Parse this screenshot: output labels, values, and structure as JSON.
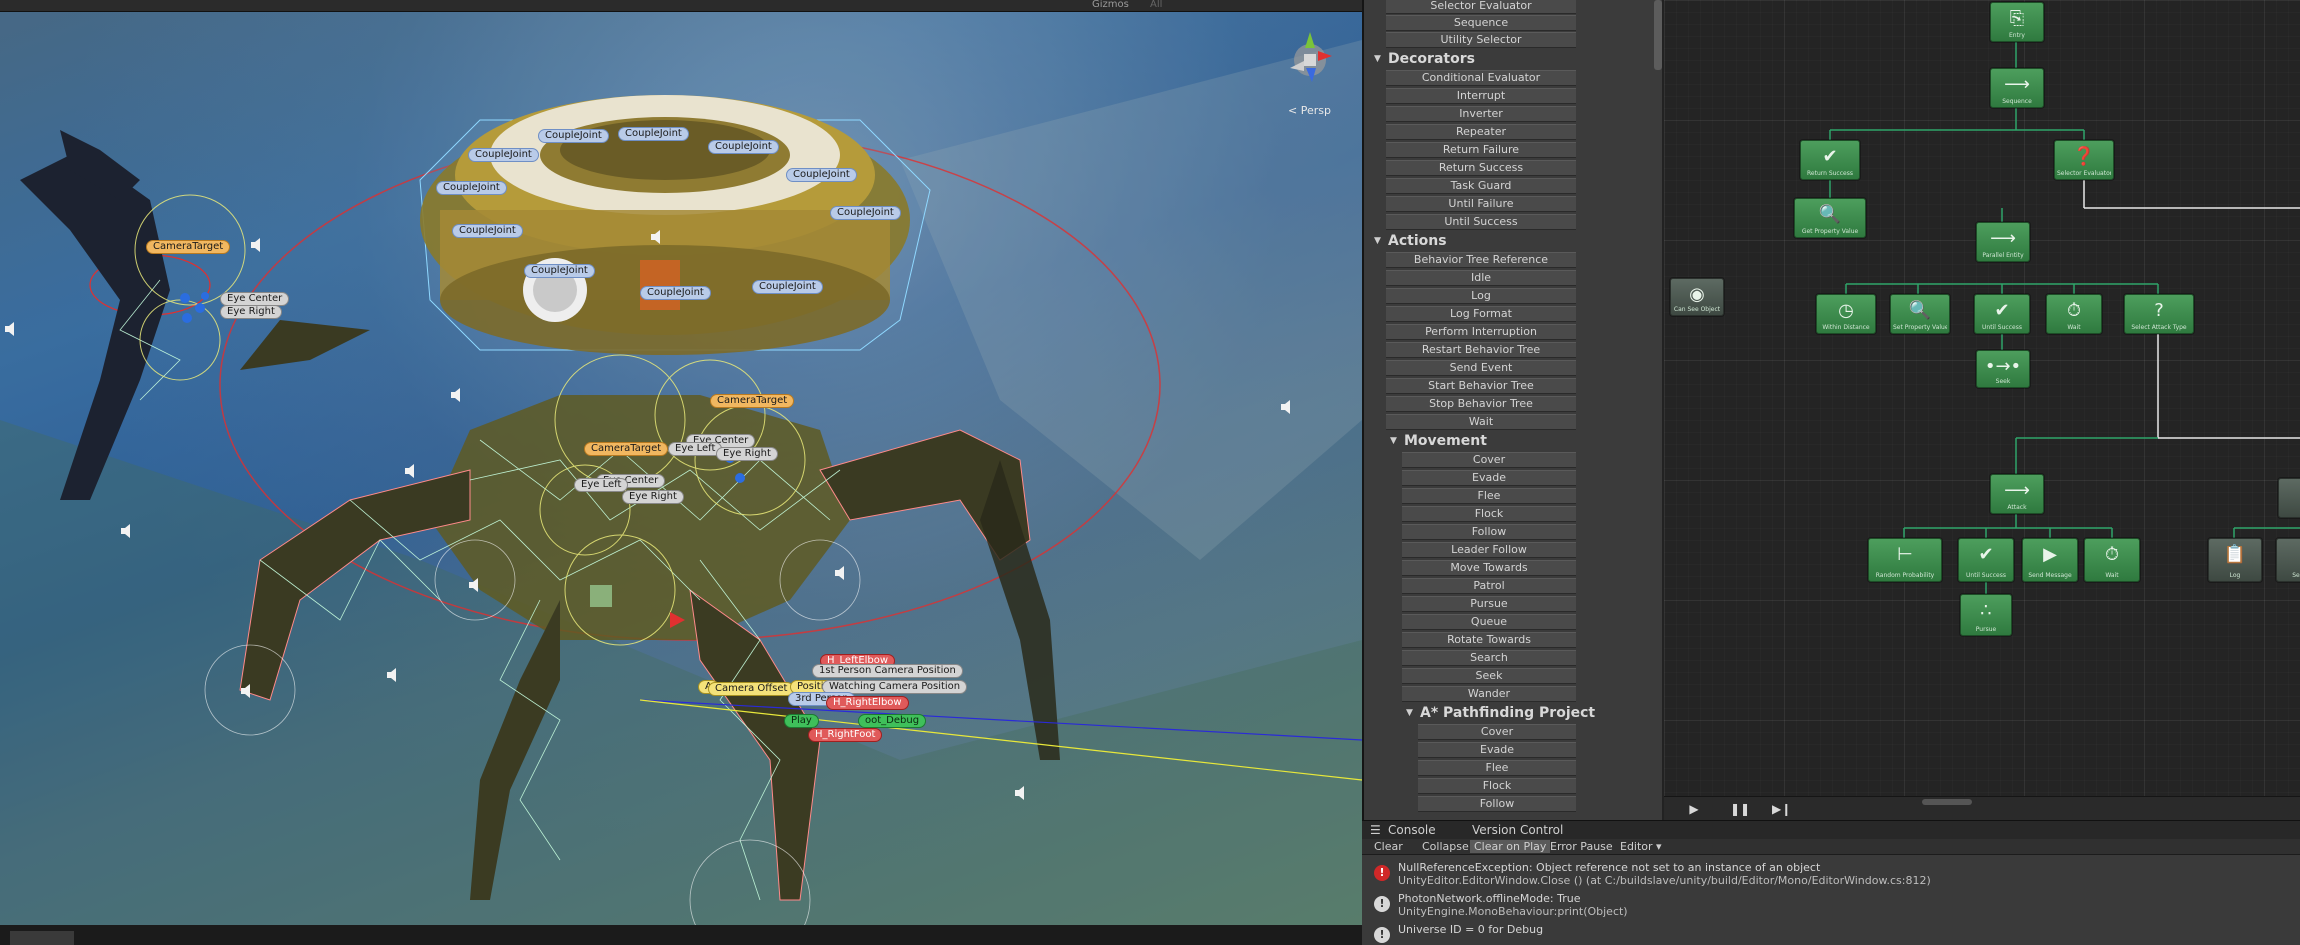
{
  "scene": {
    "toolbar": {
      "gizmos_label": "Gizmos",
      "search_label": "All"
    },
    "persp_label": "Persp",
    "labels": {
      "couplejoint": "CoupleJoint",
      "camera_target": "CameraTarget",
      "eye_center": "Eye Center",
      "eye_right": "Eye Right",
      "eye_left": "Eye Left",
      "h_left_elbow": "H_LeftElbow",
      "first_person_cam": "1st Person Camera Position",
      "camera_offset": "Camera Offset",
      "position": "Position",
      "watching_camera": "Watching Camera Position",
      "third_person": "3rd Person",
      "h_right_elbow": "H_RightElbow",
      "player_debug": "Play",
      "foot_debug": "oot_Debug",
      "h_right_foot": "H_RightFoot",
      "a_label": "A"
    }
  },
  "tasks": {
    "composites_tail": [
      "Selector Evaluator",
      "Sequence",
      "Utility Selector"
    ],
    "decorators": {
      "title": "Decorators",
      "items": [
        "Conditional Evaluator",
        "Interrupt",
        "Inverter",
        "Repeater",
        "Return Failure",
        "Return Success",
        "Task Guard",
        "Until Failure",
        "Until Success"
      ]
    },
    "actions": {
      "title": "Actions",
      "items": [
        "Behavior Tree Reference",
        "Idle",
        "Log",
        "Log Format",
        "Perform Interruption",
        "Restart Behavior Tree",
        "Send Event",
        "Start Behavior Tree",
        "Stop Behavior Tree",
        "Wait"
      ]
    },
    "movement": {
      "title": "Movement",
      "items": [
        "Cover",
        "Evade",
        "Flee",
        "Flock",
        "Follow",
        "Leader Follow",
        "Move Towards",
        "Patrol",
        "Pursue",
        "Queue",
        "Rotate Towards",
        "Search",
        "Seek",
        "Wander"
      ]
    },
    "pathfinding": {
      "title": "A* Pathfinding Project",
      "items": [
        "Cover",
        "Evade",
        "Flee",
        "Flock",
        "Follow"
      ]
    }
  },
  "graph": {
    "nodes": {
      "entry": {
        "label": "Entry"
      },
      "root_seq": {
        "label": "Sequence"
      },
      "return_success": {
        "label": "Return Success"
      },
      "selector_eval": {
        "label": "Selector Evaluator"
      },
      "get_property": {
        "label": "Get Property Value"
      },
      "can_see": {
        "label": "Can See Object"
      },
      "inner_seq": {
        "label": "Parallel Entity"
      },
      "within_distance": {
        "label": "Within Distance"
      },
      "set_property": {
        "label": "Set Property Value"
      },
      "wait_success": {
        "label": "Until Success"
      },
      "wait": {
        "label": "Wait"
      },
      "select_attack": {
        "label": "Select Attack Type"
      },
      "seek": {
        "label": "Seek"
      },
      "attack_seq": {
        "label": "Attack"
      },
      "random_probability": {
        "label": "Random Probability"
      },
      "until_success2": {
        "label": "Until Success"
      },
      "send_message": {
        "label": "Send Message"
      },
      "wait2": {
        "label": "Wait"
      },
      "pursue": {
        "label": "Pursue"
      },
      "log": {
        "label": "Log"
      },
      "edge_node": {
        "label": "Se"
      }
    }
  },
  "console": {
    "tabs": [
      "Console",
      "Version Control"
    ],
    "toolbar": [
      "Clear",
      "Collapse",
      "Clear on Play",
      "Error Pause",
      "Editor ▾"
    ],
    "messages": [
      {
        "type": "error",
        "line1": "NullReferenceException: Object reference not set to an instance of an object",
        "line2": "UnityEditor.EditorWindow.Close () (at C:/buildslave/unity/build/Editor/Mono/EditorWindow.cs:812)"
      },
      {
        "type": "info",
        "line1": "PhotonNetwork.offlineMode: True",
        "line2": "UnityEngine.MonoBehaviour:print(Object)"
      },
      {
        "type": "info",
        "line1": "Universe ID = 0 for Debug",
        "line2": ""
      }
    ]
  }
}
